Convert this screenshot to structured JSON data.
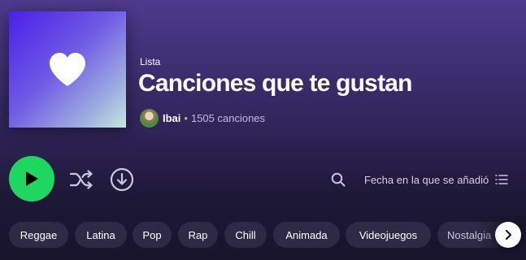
{
  "playlist": {
    "type_label": "Lista",
    "title": "Canciones que te gustan",
    "owner": "Ibai",
    "separator": "•",
    "song_count": "1505 canciones",
    "cover_icon": "heart-icon"
  },
  "controls": {
    "play_icon": "play-icon",
    "shuffle_icon": "shuffle-icon",
    "download_icon": "download-icon",
    "search_icon": "search-icon",
    "sort_label": "Fecha en la que se añadió",
    "sort_icon": "list-icon"
  },
  "filters": {
    "chips": [
      "Reggae",
      "Latina",
      "Pop",
      "Rap",
      "Chill",
      "Animada",
      "Videojuegos",
      "Nostalgia"
    ],
    "next_icon": "chevron-right-icon"
  },
  "colors": {
    "accent_green": "#1ed760",
    "chip_bg": "#2e2a45"
  }
}
